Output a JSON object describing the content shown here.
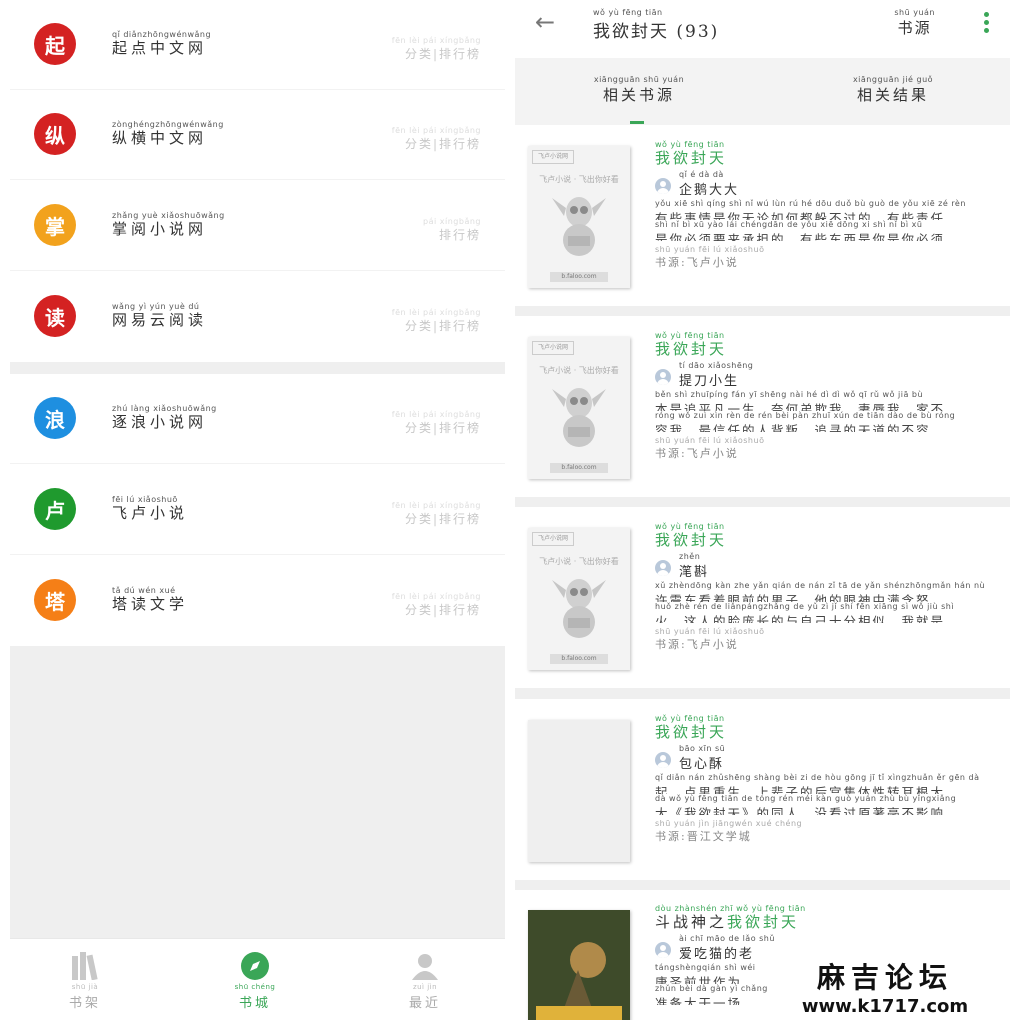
{
  "left": {
    "sources": [
      {
        "icon": "qidian-logo-icon",
        "glyph": "起",
        "color": "#d42222",
        "pinyin": "qǐ diǎnzhōngwénwǎng",
        "name": "起点中文网",
        "links_pinyin": "fēn lèi  pái xíngbǎng",
        "links": "分类|排行榜"
      },
      {
        "icon": "zongheng-logo-icon",
        "glyph": "纵",
        "color": "#d42222",
        "pinyin": "zònghéngzhōngwénwǎng",
        "name": "纵横中文网",
        "links_pinyin": "fēn lèi  pái xíngbǎng",
        "links": "分类|排行榜"
      },
      {
        "icon": "zhangyue-logo-icon",
        "glyph": "掌",
        "color": "#f2a21d",
        "pinyin": "zhǎng yuè xiǎoshuōwǎng",
        "name": "掌阅小说网",
        "links_pinyin": "pái xíngbǎng",
        "links": "排行榜"
      },
      {
        "icon": "netease-read-logo-icon",
        "glyph": "读",
        "color": "#d42222",
        "pinyin": "wǎng yì yún yuè dú",
        "name": "网易云阅读",
        "links_pinyin": "fēn lèi  pái xíngbǎng",
        "links": "分类|排行榜"
      },
      {
        "icon": "zhulang-logo-icon",
        "glyph": "浪",
        "color": "#1e8fe0",
        "pinyin": "zhú làng xiǎoshuōwǎng",
        "name": "逐浪小说网",
        "links_pinyin": "fēn lèi  pái xíngbǎng",
        "links": "分类|排行榜"
      },
      {
        "icon": "feilu-logo-icon",
        "glyph": "卢",
        "color": "#1f9a2e",
        "pinyin": "fēi lú xiǎoshuō",
        "name": "飞卢小说",
        "links_pinyin": "fēn lèi  pái xíngbǎng",
        "links": "分类|排行榜"
      },
      {
        "icon": "tadu-logo-icon",
        "glyph": "塔",
        "color": "#f57f17",
        "pinyin": "tǎ dú wén xué",
        "name": "塔读文学",
        "links_pinyin": "fēn lèi  pái xíngbǎng",
        "links": "分类|排行榜"
      }
    ],
    "nav": {
      "shelf": {
        "pinyin": "shū jià",
        "label": "书架"
      },
      "store": {
        "pinyin": "shū chéng",
        "label": "书城"
      },
      "recent": {
        "pinyin": "zuì jìn",
        "label": "最近"
      }
    }
  },
  "right": {
    "header": {
      "title_pinyin": "wǒ yù fēng tiān",
      "title": "我欲封天 (93)",
      "source_pinyin": "shū yuán",
      "source": "书源"
    },
    "tabs": [
      {
        "pinyin": "xiāngguān shū yuán",
        "label": "相关书源"
      },
      {
        "pinyin": "xiāngguān jié guǒ",
        "label": "相关结果"
      }
    ],
    "cover_placeholder": {
      "badge": "飞卢小说网",
      "slogan": "飞卢小说 · 飞出你好看",
      "url": "b.faloo.com"
    },
    "results": [
      {
        "title_pinyin": "wǒ yù fēng tiān",
        "title_prefix": "",
        "title": "我欲封天",
        "author_pinyin": "qǐ é dà dà",
        "author": "企鹅大大",
        "desc_pinyin_1": "yǒu xiē shì qíng shì nǐ wú lùn rú hé dōu duǒ bù guò de    yǒu xiē zé rèn",
        "desc_1": "有些事情是你无论如何都躲不过的。有些责任",
        "desc_pinyin_2": "shì nǐ bì xū yào lái chéngdān de    yǒu xiē dōng xi shì nǐ bì xū",
        "desc_2": "是你必须要来承担的。有些东西是你是你必须...",
        "src_pinyin": "shū yuán  fēi lú xiǎoshuō",
        "src": "书源:飞卢小说",
        "cover": "placeholder"
      },
      {
        "title_pinyin": "wǒ yù fēng tiān",
        "title_prefix": "",
        "title": "我欲封天",
        "author_pinyin": "tí dāo xiǎoshēng",
        "author": "提刀小生",
        "desc_pinyin_1": "běn shì zhuīpíng fán yī shēng  nài hé dì dì wǒ  qī rǔ wǒ  jiā bù",
        "desc_1": "本是追平凡一生，奈何弟欺我，妻辱我，家不",
        "desc_pinyin_2": "róng wǒ  zuì xìn rèn de rén bèi pàn  zhuī xún de tiān dào de bù róng",
        "desc_2": "容我，最信任的人背叛，追寻的天道的不容，...",
        "src_pinyin": "shū yuán  fēi lú xiǎoshuō",
        "src": "书源:飞卢小说",
        "cover": "placeholder"
      },
      {
        "title_pinyin": "wǒ yù fēng tiān",
        "title_prefix": "",
        "title": "我欲封天",
        "author_pinyin": "zhěn",
        "author": "滗斟",
        "desc_pinyin_1": "xǔ zhèndōng kàn zhe yǎn qián de nán zǐ  tā de yǎn shénzhōngmǎn hán nù",
        "desc_1": "许震东看着眼前的男子，他的眼神中满含怒",
        "desc_pinyin_2": "huǒ  zhè rén de liǎnpángzhǎng de yǔ zì jǐ shí fēn xiāng sì  wǒ jiù shì",
        "desc_2": "火，这人的脸庞长的与自己十分相似。我就是...",
        "src_pinyin": "shū yuán  fēi lú xiǎoshuō",
        "src": "书源:飞卢小说",
        "cover": "placeholder"
      },
      {
        "title_pinyin": "wǒ yù fēng tiān",
        "title_prefix": "",
        "title": "我欲封天",
        "author_pinyin": "bāo xīn sū",
        "author": "包心酥",
        "desc_pinyin_1": "qǐ  diǎn nán zhǔshēng  shàng bèi zi de hòu gōng jī tǐ xìngzhuǎn ěr gēn dà",
        "desc_1": "起、点男重生，上辈子的后宫集体性转耳根大",
        "desc_pinyin_2": "dà  wǒ yù fēng tiān   de tóng rén  méi kàn guò yuán zhù bù yǐngxiǎng",
        "desc_2": "大《我欲封天》的同人，没看过原著毫不影响...",
        "src_pinyin": "shū yuán  jìn jiāngwén xué chéng",
        "src": "书源:晋江文学城",
        "cover": "blank"
      },
      {
        "title_pinyin": "dòu zhànshén zhī wǒ yù fēng tiān",
        "title_prefix": "斗战神之",
        "title": "我欲封天",
        "author_pinyin": "ài chī māo de lǎo shǔ",
        "author": "爱吃猫的老",
        "desc_pinyin_1": "tángshèngqián shì wéi",
        "desc_1": "唐圣前世作为",
        "desc_pinyin_2": "zhǔn bèi dà gàn yì chǎng",
        "desc_2": "准备大干一场",
        "src_pinyin": "",
        "src": "",
        "cover": "art"
      }
    ]
  },
  "watermark": {
    "line1": "麻吉论坛",
    "line2": "www.k1717.com"
  }
}
